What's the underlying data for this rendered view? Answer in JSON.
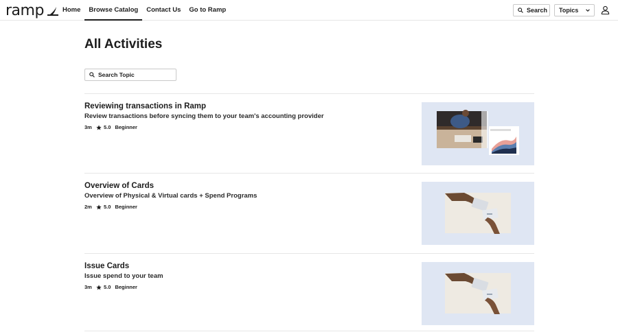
{
  "brand": {
    "name": "ramp"
  },
  "nav": {
    "items": [
      {
        "label": "Home",
        "active": false
      },
      {
        "label": "Browse Catalog",
        "active": true
      },
      {
        "label": "Contact Us",
        "active": false
      },
      {
        "label": "Go to Ramp",
        "active": false
      }
    ]
  },
  "header": {
    "search_label": "Search",
    "topics_label": "Topics"
  },
  "page": {
    "title": "All Activities",
    "search_placeholder": "Search Topic"
  },
  "activities": [
    {
      "title": "Reviewing transactions in Ramp",
      "subtitle": "Review transactions before syncing them to your team's accounting provider",
      "duration": "3m",
      "rating": "5.0",
      "level": "Beginner",
      "thumbnail": "desk-laptop-charts"
    },
    {
      "title": "Overview of Cards",
      "subtitle": "Overview of Physical & Virtual cards + Spend Programs",
      "duration": "2m",
      "rating": "5.0",
      "level": "Beginner",
      "thumbnail": "hands-passing-card"
    },
    {
      "title": "Issue Cards",
      "subtitle": "Issue spend to your team",
      "duration": "3m",
      "rating": "5.0",
      "level": "Beginner",
      "thumbnail": "hands-passing-card"
    }
  ],
  "colors": {
    "thumb_bg": "#dfe6f3",
    "text": "#1c1c1c",
    "divider": "#e6e6e6"
  }
}
